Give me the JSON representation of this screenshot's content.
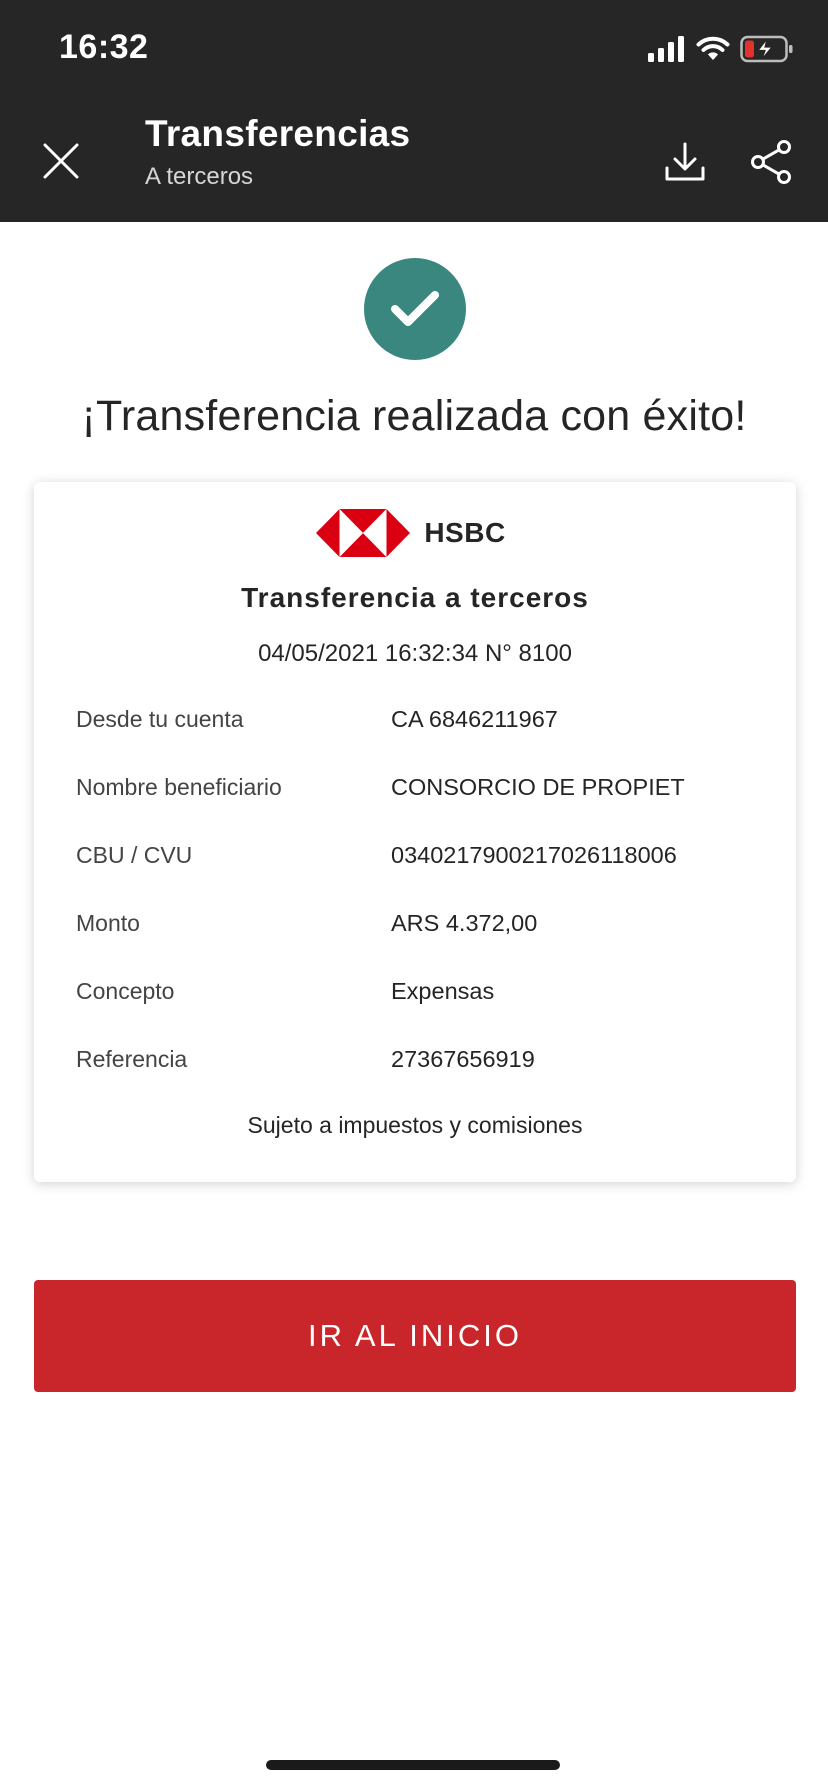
{
  "status_bar": {
    "time": "16:32",
    "icons": [
      "cellular-signal-icon",
      "wifi-icon",
      "battery-charging-icon"
    ]
  },
  "header": {
    "title": "Transferencias",
    "subtitle": "A terceros",
    "icons": [
      "close-icon",
      "download-icon",
      "share-icon"
    ]
  },
  "success": {
    "icon": "checkmark-circle-icon",
    "message": "¡Transferencia realizada con éxito!"
  },
  "receipt": {
    "bank_name": "HSBC",
    "title": "Transferencia a terceros",
    "datetime": "04/05/2021 16:32:34 N° 8100",
    "rows": [
      {
        "label": "Desde tu cuenta",
        "value": "CA 6846211967"
      },
      {
        "label": "Nombre beneficiario",
        "value": "CONSORCIO DE PROPIET"
      },
      {
        "label": "CBU / CVU",
        "value": "0340217900217026118006"
      },
      {
        "label": "Monto",
        "value": "ARS 4.372,00"
      },
      {
        "label": "Concepto",
        "value": "Expensas"
      },
      {
        "label": "Referencia",
        "value": "27367656919"
      }
    ],
    "footer": "Sujeto a impuestos y comisiones"
  },
  "actions": {
    "home_label": "IR AL INICIO"
  },
  "colors": {
    "header_bg": "#262626",
    "success_green": "#3a877f",
    "brand_red": "#c8262a",
    "battery_red": "#e2322d"
  }
}
